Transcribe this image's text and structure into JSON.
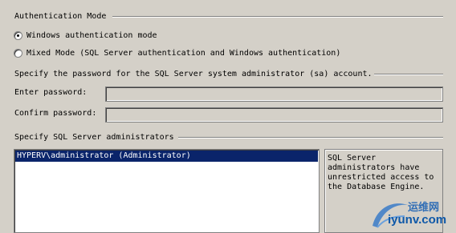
{
  "auth_mode": {
    "title": "Authentication Mode",
    "options": [
      {
        "label": "Windows authentication mode",
        "checked": true
      },
      {
        "label": "Mixed Mode (SQL Server authentication and Windows authentication)",
        "checked": false
      }
    ]
  },
  "sa_password": {
    "title": "Specify the password for the SQL Server system administrator (sa) account.",
    "enter_label": "Enter password:",
    "enter_value": "",
    "confirm_label": "Confirm password:",
    "confirm_value": ""
  },
  "admins": {
    "title": "Specify SQL Server administrators",
    "items": [
      {
        "label": "HYPERV\\administrator (Administrator)",
        "selected": true
      }
    ],
    "info": "SQL Server\nadministrators have\nunrestricted access to\nthe Database Engine."
  },
  "watermark": {
    "top": "运维网",
    "bottom": "iyunv.com"
  },
  "colors": {
    "background": "#d4d0c8",
    "selection": "#0a246a",
    "watermark": "#1e5fa8"
  }
}
